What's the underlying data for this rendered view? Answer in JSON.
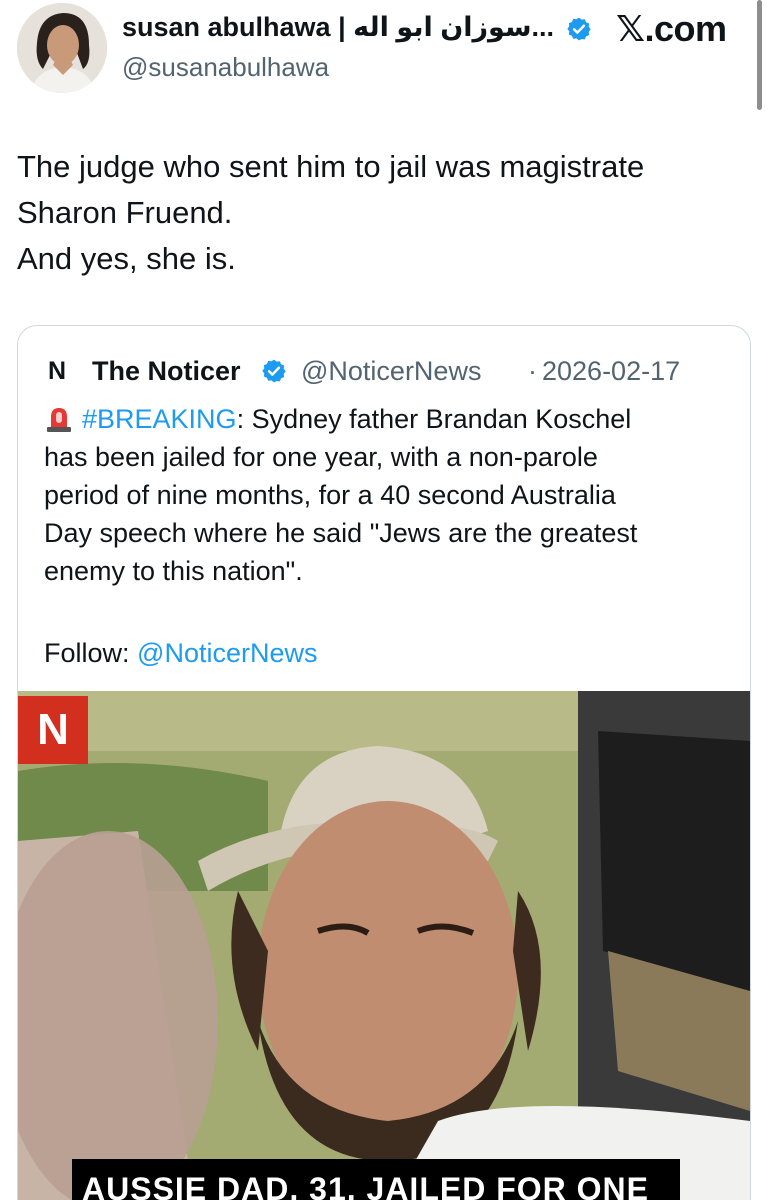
{
  "header": {
    "author_name": "susan abulhawa | سوزان ابو اله...",
    "handle": "@susanabulhawa",
    "site_label": "𝕏.com"
  },
  "tweet": {
    "lines": [
      "The judge who sent him to jail was magistrate",
      "Sharon Fruend.",
      "And yes, she is."
    ]
  },
  "quote": {
    "logo": "N",
    "name": "The Noticer",
    "handle": "@NoticerNews",
    "separator": "·",
    "date": "2026-02-17",
    "hashtag": "#BREAKING",
    "line1_rest": ": Sydney father Brandan Koschel",
    "lines": [
      "has been jailed for one year, with a non-parole",
      "period of nine months, for a 40 second Australia",
      "Day speech where he said \"Jews are the greatest",
      "enemy to this nation\"."
    ],
    "follow_label": "Follow: ",
    "follow_handle": "@NoticerNews"
  },
  "media": {
    "badge": "N",
    "banner_text": "AUSSIE DAD, 31, JAILED FOR ONE"
  },
  "colors": {
    "link": "#1d9bf0",
    "verified": "#1d9bf0",
    "badge_red": "#d32f1f"
  }
}
